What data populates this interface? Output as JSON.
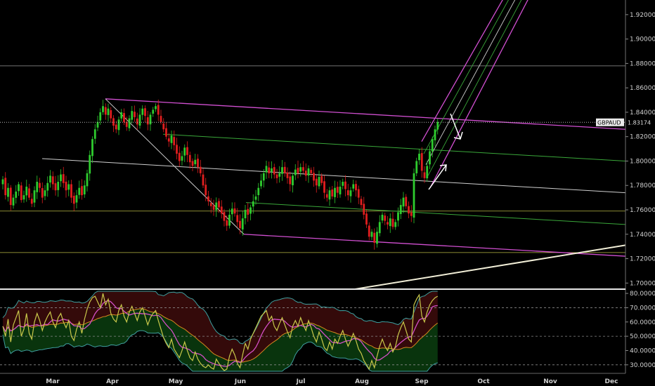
{
  "chart_data": {
    "type": "candlestick",
    "symbol": "GBPAUD",
    "current_price": "1.83174",
    "ylim": [
      1.695,
      1.932
    ],
    "price_ticks": [
      "1.92000",
      "1.90000",
      "1.88000",
      "1.86000",
      "1.84000",
      "1.82000",
      "1.80000",
      "1.78000",
      "1.76000",
      "1.74000",
      "1.72000",
      "1.70000"
    ],
    "price_tick_values": [
      1.92,
      1.9,
      1.88,
      1.86,
      1.84,
      1.82,
      1.8,
      1.78,
      1.76,
      1.74,
      1.72,
      1.7
    ],
    "months": [
      "Mar",
      "Apr",
      "May",
      "Jun",
      "Jul",
      "Aug",
      "Sep",
      "Oct",
      "Nov",
      "Dec"
    ],
    "rsi_ticks": [
      "80.0000",
      "70.0000",
      "60.0000",
      "50.0000",
      "40.0000",
      "30.0000"
    ],
    "rsi_tick_values": [
      80,
      70,
      60,
      50,
      40,
      30
    ],
    "rsi_range": [
      25,
      82
    ],
    "close_series": [
      1.785,
      1.772,
      1.778,
      1.764,
      1.77,
      1.775,
      1.781,
      1.768,
      1.772,
      1.779,
      1.77,
      1.765,
      1.776,
      1.783,
      1.778,
      1.77,
      1.776,
      1.782,
      1.788,
      1.781,
      1.776,
      1.783,
      1.789,
      1.782,
      1.776,
      1.781,
      1.77,
      1.765,
      1.772,
      1.778,
      1.772,
      1.78,
      1.79,
      1.805,
      1.818,
      1.826,
      1.832,
      1.84,
      1.845,
      1.838,
      1.843,
      1.835,
      1.829,
      1.826,
      1.834,
      1.84,
      1.832,
      1.828,
      1.835,
      1.841,
      1.836,
      1.83,
      1.838,
      1.843,
      1.837,
      1.83,
      1.838,
      1.842,
      1.845,
      1.838,
      1.832,
      1.826,
      1.82,
      1.816,
      1.821,
      1.813,
      1.806,
      1.8,
      1.804,
      1.811,
      1.805,
      1.799,
      1.796,
      1.801,
      1.795,
      1.79,
      1.78,
      1.772,
      1.767,
      1.763,
      1.76,
      1.766,
      1.762,
      1.757,
      1.751,
      1.747,
      1.756,
      1.761,
      1.757,
      1.75,
      1.745,
      1.753,
      1.76,
      1.756,
      1.762,
      1.767,
      1.771,
      1.778,
      1.784,
      1.79,
      1.796,
      1.79,
      1.794,
      1.789,
      1.786,
      1.79,
      1.795,
      1.79,
      1.786,
      1.781,
      1.788,
      1.793,
      1.79,
      1.795,
      1.792,
      1.788,
      1.794,
      1.79,
      1.784,
      1.78,
      1.787,
      1.782,
      1.774,
      1.77,
      1.776,
      1.771,
      1.778,
      1.774,
      1.779,
      1.783,
      1.777,
      1.772,
      1.776,
      1.781,
      1.776,
      1.77,
      1.764,
      1.756,
      1.748,
      1.738,
      1.742,
      1.733,
      1.742,
      1.75,
      1.756,
      1.751,
      1.748,
      1.753,
      1.746,
      1.75,
      1.758,
      1.764,
      1.77,
      1.763,
      1.757,
      1.755,
      1.79,
      1.8,
      1.806,
      1.792,
      1.786,
      1.796,
      1.808,
      1.818,
      1.826,
      1.832
    ],
    "ohlc_note": "",
    "rsi_series": [
      57,
      50,
      62,
      46,
      58,
      63,
      68,
      50,
      55,
      66,
      52,
      48,
      60,
      66,
      61,
      54,
      60,
      64,
      67,
      60,
      56,
      63,
      66,
      60,
      56,
      61,
      50,
      47,
      55,
      60,
      52,
      62,
      69,
      74,
      77,
      78,
      74,
      70,
      80,
      72,
      76,
      66,
      62,
      60,
      68,
      72,
      64,
      60,
      67,
      71,
      66,
      61,
      67,
      70,
      64,
      58,
      63,
      66,
      68,
      61,
      55,
      49,
      45,
      42,
      48,
      41,
      38,
      35,
      40,
      46,
      40,
      35,
      33,
      39,
      34,
      31,
      29,
      28,
      30,
      28,
      27,
      34,
      31,
      28,
      26,
      27,
      36,
      41,
      37,
      31,
      28,
      37,
      45,
      41,
      48,
      52,
      56,
      60,
      64,
      66,
      68,
      61,
      64,
      57,
      54,
      59,
      63,
      58,
      53,
      49,
      57,
      61,
      57,
      63,
      58,
      54,
      61,
      56,
      50,
      46,
      53,
      48,
      42,
      40,
      46,
      41,
      48,
      45,
      50,
      54,
      48,
      43,
      47,
      52,
      47,
      41,
      38,
      33,
      30,
      27,
      33,
      28,
      36,
      43,
      48,
      43,
      40,
      45,
      39,
      43,
      51,
      56,
      60,
      54,
      48,
      46,
      72,
      76,
      79,
      64,
      60,
      67,
      72,
      75,
      77,
      78
    ],
    "rsi_fast_series": [],
    "levels_horizontal": [
      1.878,
      1.759,
      1.725
    ],
    "colors": {
      "up": "#2ecc2e",
      "down": "#e01e1e",
      "channel": "#d14fd1",
      "green_line": "#3aa83a",
      "white_line": "#cfcfcf",
      "level_line": "#b8b845",
      "gray_level": "#9a9a9a",
      "trendline": "#f2efd8",
      "rsi": "#c9c84a",
      "rsi_ma": "#d44fc6",
      "band_mid": "#d6871f",
      "band_outer": "#3f9f9f"
    }
  }
}
